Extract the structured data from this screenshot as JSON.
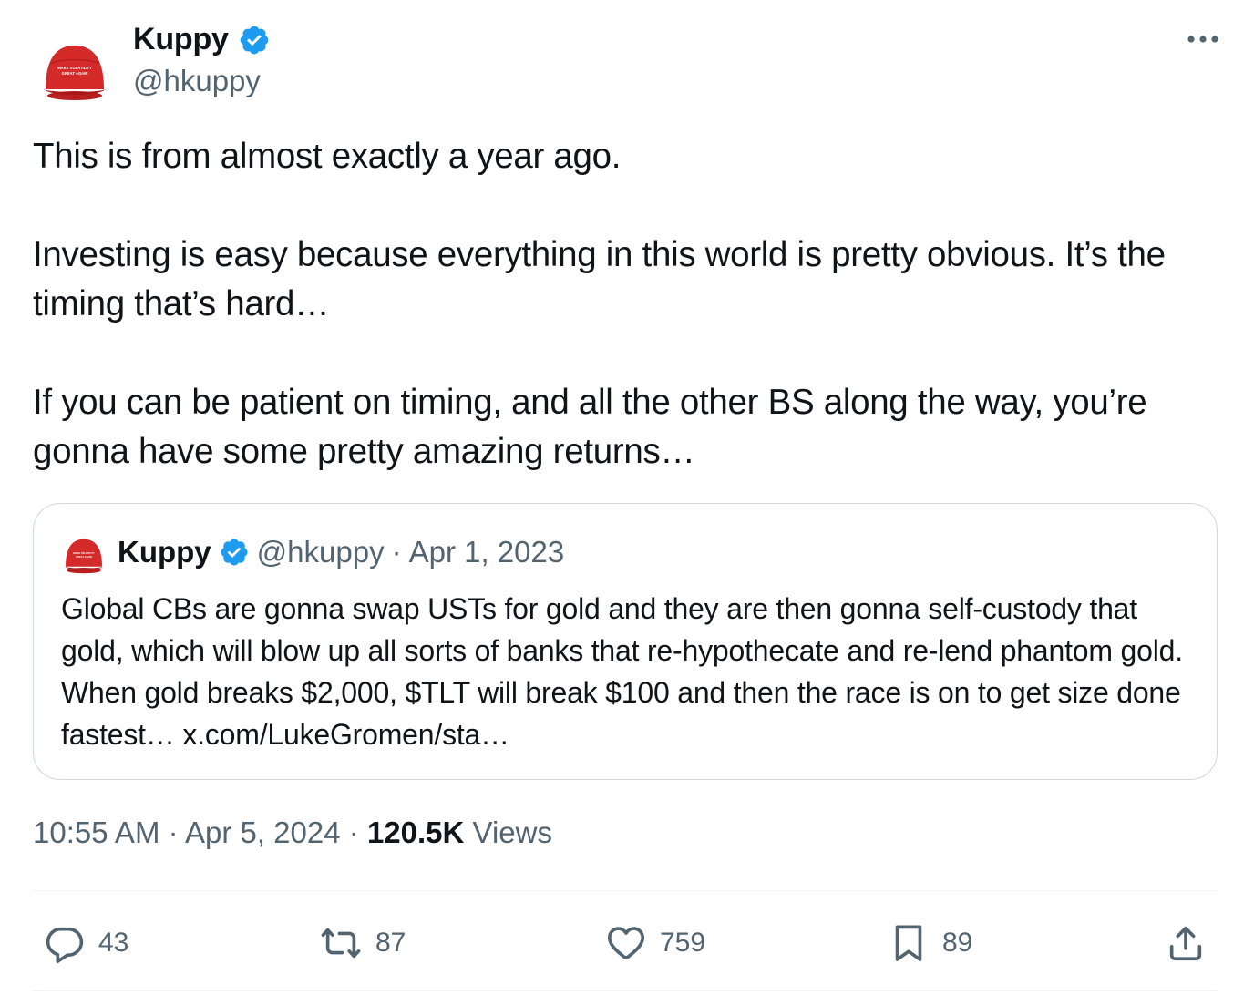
{
  "author": {
    "display_name": "Kuppy",
    "handle": "@hkuppy",
    "verified": true,
    "avatar_icon": "red-hat-avatar",
    "avatar_hat_text": [
      "MAKE VOLATILITY",
      "GREAT AGAIN"
    ]
  },
  "tweet": {
    "paragraphs": [
      "This is from almost exactly a year ago.",
      "Investing is easy because everything in this world is pretty obvious. It’s the timing that’s hard…",
      "If you can be patient on timing, and all the other BS along the way, you’re gonna have some pretty amazing returns…"
    ],
    "time": "10:55 AM",
    "date": "Apr 5, 2024",
    "views_count": "120.5K",
    "views_label": "Views",
    "separator": "·"
  },
  "quote": {
    "display_name": "Kuppy",
    "handle": "@hkuppy",
    "separator": "·",
    "date": "Apr 1, 2023",
    "text": "Global CBs are gonna swap USTs for gold and they are then gonna self-custody that gold, which will blow up all sorts of banks that re-hypothecate and re-lend phantom gold. When gold breaks $2,000, $TLT will break $100 and then the race is on to get size done fastest… x.com/LukeGromen/sta…"
  },
  "actions": {
    "replies": "43",
    "retweets": "87",
    "likes": "759",
    "bookmarks": "89"
  },
  "colors": {
    "text_primary": "#0f1419",
    "text_secondary": "#536471",
    "verified_blue": "#1d9bf0",
    "border": "#cfd9de",
    "divider": "#eff3f4",
    "hat_red": "#d42a2a"
  },
  "icons": [
    "more-icon",
    "verified-badge-icon",
    "reply-icon",
    "retweet-icon",
    "like-icon",
    "bookmark-icon",
    "share-icon"
  ]
}
